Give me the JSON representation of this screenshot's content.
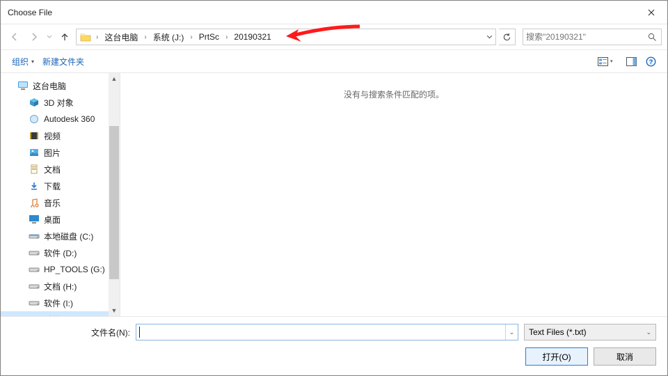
{
  "title": "Choose File",
  "breadcrumbs": [
    "这台电脑",
    "系统 (J:)",
    "PrtSc",
    "20190321"
  ],
  "search_placeholder": "搜索\"20190321\"",
  "toolbar": {
    "organize": "组织",
    "newfolder": "新建文件夹"
  },
  "empty_message": "没有与搜索条件匹配的项。",
  "sidebar": {
    "items": [
      {
        "label": "这台电脑",
        "icon": "monitor"
      },
      {
        "label": "3D 对象",
        "icon": "cube"
      },
      {
        "label": "Autodesk 360",
        "icon": "autodesk"
      },
      {
        "label": "视频",
        "icon": "video"
      },
      {
        "label": "图片",
        "icon": "pictures"
      },
      {
        "label": "文档",
        "icon": "doc"
      },
      {
        "label": "下载",
        "icon": "download"
      },
      {
        "label": "音乐",
        "icon": "music"
      },
      {
        "label": "桌面",
        "icon": "desktop"
      },
      {
        "label": "本地磁盘 (C:)",
        "icon": "drive-c"
      },
      {
        "label": "软件 (D:)",
        "icon": "drive"
      },
      {
        "label": "HP_TOOLS (G:)",
        "icon": "drive"
      },
      {
        "label": "文档 (H:)",
        "icon": "drive"
      },
      {
        "label": "软件 (I:)",
        "icon": "drive"
      },
      {
        "label": "系统 (J:)",
        "icon": "drive"
      }
    ]
  },
  "filename_label": "文件名(N):",
  "filter_label": "Text Files (*.txt)",
  "open_label": "打开(O)",
  "cancel_label": "取消"
}
